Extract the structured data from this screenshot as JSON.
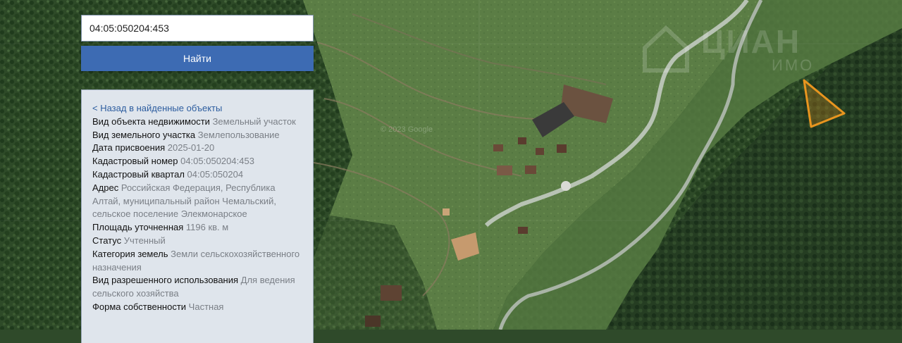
{
  "search": {
    "value": "04:05:050204:453",
    "button_label": "Найти"
  },
  "map": {
    "watermark": "ЦИАН",
    "watermark_sub": "ИМО",
    "copyright": "© 2023 Google",
    "parcel_color": "#e8951f"
  },
  "panel": {
    "back_link": "< Назад в найденные объекты",
    "rows": [
      {
        "label": "Вид объекта недвижимости",
        "value": "Земельный участок"
      },
      {
        "label": "Вид земельного участка",
        "value": "Землепользование"
      },
      {
        "label": "Дата присвоения",
        "value": "2025-01-20"
      },
      {
        "label": "Кадастровый номер",
        "value": "04:05:050204:453"
      },
      {
        "label": "Кадастровый квартал",
        "value": "04:05:050204"
      },
      {
        "label": "Адрес",
        "value": "Российская Федерация, Республика Алтай, муниципальный район Чемальский, сельское поселение Элекмонарское"
      },
      {
        "label": "Площадь уточненная",
        "value": "1196 кв. м"
      },
      {
        "label": "Статус",
        "value": "Учтенный"
      },
      {
        "label": "Категория земель",
        "value": "Земли сельскохозяйственного назначения"
      },
      {
        "label": "Вид разрешенного использования",
        "value": "Для ведения сельского хозяйства"
      },
      {
        "label": "Форма собственности",
        "value": "Частная"
      }
    ]
  }
}
